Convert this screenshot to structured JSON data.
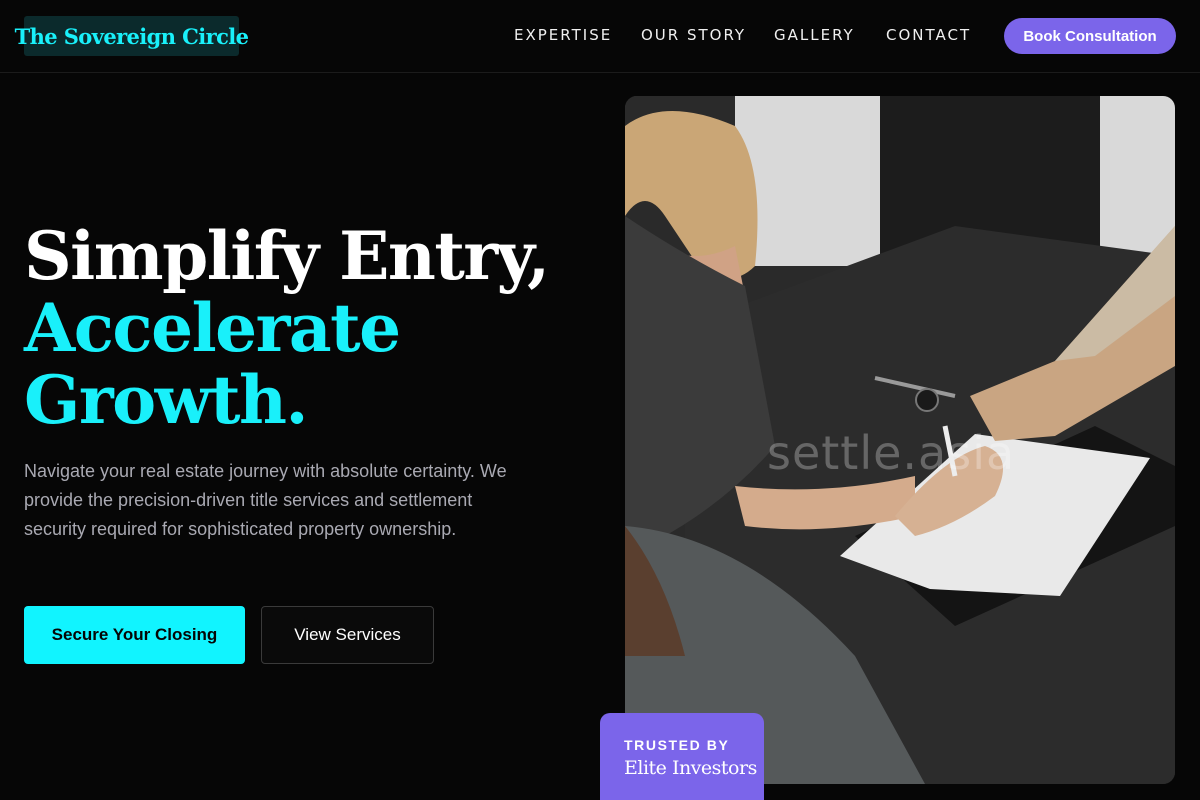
{
  "header": {
    "logo_text": "The Sovereign Circle",
    "nav": [
      {
        "label": "EXPERTISE"
      },
      {
        "label": "OUR STORY"
      },
      {
        "label": "GALLERY"
      },
      {
        "label": "CONTACT"
      }
    ],
    "cta_label": "Book Consultation"
  },
  "hero": {
    "headline_line1": "Simplify Entry,",
    "headline_line2": "Accelerate",
    "headline_line3": "Growth.",
    "lead": "Navigate your real estate journey with absolute certainty. We provide the precision-driven title services and settlement security required for sophisticated property ownership.",
    "primary_button": "Secure Your Closing",
    "secondary_button": "View Services",
    "image_watermark": "settle.asia"
  },
  "badge": {
    "kicker": "TRUSTED BY",
    "title": "Elite Investors"
  },
  "colors": {
    "accent_cyan": "#11f4ff",
    "accent_purple": "#7b65ea",
    "background": "#060606"
  }
}
